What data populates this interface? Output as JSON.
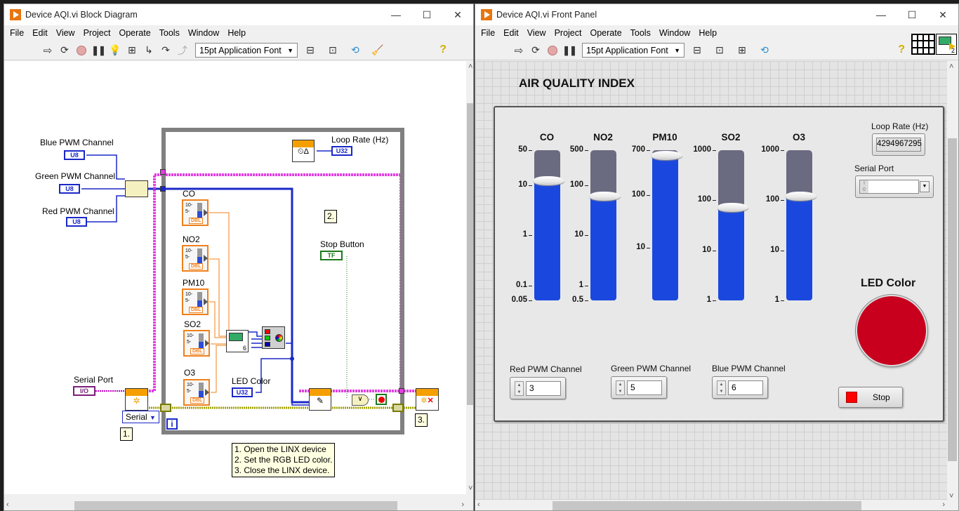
{
  "block_diagram": {
    "title": "Device AQI.vi Block Diagram",
    "window_controls": {
      "minimize": "—",
      "maximize": "☐",
      "close": "✕"
    },
    "menu": [
      "File",
      "Edit",
      "View",
      "Project",
      "Operate",
      "Tools",
      "Window",
      "Help"
    ],
    "toolbar": {
      "font_select": "15pt Application Font"
    },
    "labels": {
      "blue_pwm": "Blue PWM Channel",
      "green_pwm": "Green PWM Channel",
      "red_pwm": "Red PWM Channel",
      "loop_rate": "Loop Rate (Hz)",
      "stop_button": "Stop Button",
      "co": "CO",
      "no2": "NO2",
      "pm10": "PM10",
      "so2": "SO2",
      "o3": "O3",
      "led_color": "LED Color",
      "serial_port": "Serial Port"
    },
    "terminals": {
      "u8": "U8",
      "u32": "U32",
      "tf": "TF",
      "io": "I/O",
      "dbl": "DBL"
    },
    "enum_value": "Serial",
    "loop_iteration": "i",
    "step_notes": {
      "step1": "1.",
      "step2": "2.",
      "step3": "3."
    },
    "comment": [
      "1. Open the LINX device",
      "2. Set the RGB LED color.",
      "3. Close the LINX device."
    ]
  },
  "front_panel": {
    "title": "Device AQI.vi Front Panel",
    "window_controls": {
      "minimize": "—",
      "maximize": "☐",
      "close": "✕"
    },
    "menu": [
      "File",
      "Edit",
      "View",
      "Project",
      "Operate",
      "Tools",
      "Window",
      "Help"
    ],
    "toolbar": {
      "font_select": "15pt Application Font"
    },
    "heading": "AIR QUALITY INDEX",
    "tanks": [
      {
        "label": "CO",
        "scale": [
          "50",
          "10",
          "1",
          "0.1",
          "0.05"
        ],
        "range": [
          0.05,
          50
        ],
        "value": 12
      },
      {
        "label": "NO2",
        "scale": [
          "500",
          "100",
          "10",
          "1",
          "0.5"
        ],
        "range": [
          0.5,
          500
        ],
        "value": 60
      },
      {
        "label": "PM10",
        "scale": [
          "700",
          "100",
          "10"
        ],
        "range": [
          1,
          700
        ],
        "value": 550
      },
      {
        "label": "SO2",
        "scale": [
          "1000",
          "100",
          "10",
          "1"
        ],
        "range": [
          1,
          1000
        ],
        "value": 70
      },
      {
        "label": "O3",
        "scale": [
          "1000",
          "100",
          "10",
          "1"
        ],
        "range": [
          1,
          1000
        ],
        "value": 120
      }
    ],
    "loop_rate": {
      "label": "Loop Rate (Hz)",
      "value": "4294967295"
    },
    "serial_port": {
      "label": "Serial Port",
      "value": ""
    },
    "red_pwm": {
      "label": "Red PWM Channel",
      "value": "3"
    },
    "green_pwm": {
      "label": "Green PWM Channel",
      "value": "5"
    },
    "blue_pwm": {
      "label": "Blue PWM Channel",
      "value": "6"
    },
    "led_color": {
      "label": "LED Color",
      "color": "#c8001e"
    },
    "stop": {
      "label": "Stop"
    }
  }
}
